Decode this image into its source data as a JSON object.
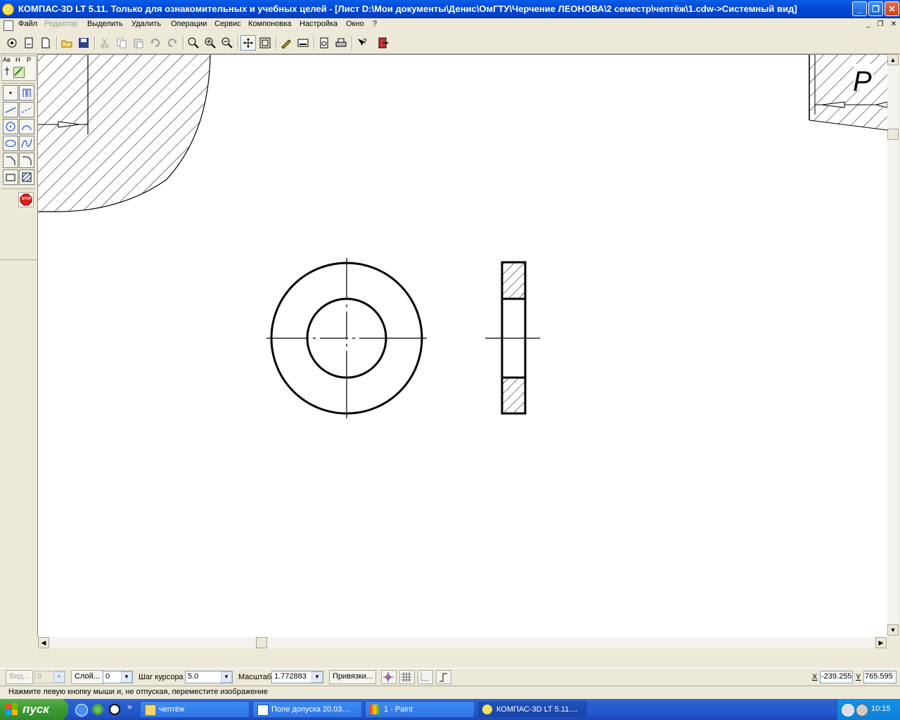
{
  "titlebar": {
    "title": "КОМПАС-3D LT 5.11. Только для ознакомительных и учебных целей - [Лист D:\\Мои документы\\Денис\\ОмГТУ\\Черчение ЛЕОНОВА\\2 семестр\\чептёж\\1.cdw->Системный вид]"
  },
  "menu": {
    "items": [
      {
        "label": "Файл"
      },
      {
        "label": "Редактор"
      },
      {
        "label": "Выделить"
      },
      {
        "label": "Удалить"
      },
      {
        "label": "Операции"
      },
      {
        "label": "Сервис"
      },
      {
        "label": "Компоновка"
      },
      {
        "label": "Настройка"
      },
      {
        "label": "Окно"
      },
      {
        "label": "?"
      }
    ]
  },
  "toolbar": {
    "icons": [
      "new-sheet-icon",
      "new-fragment-icon",
      "new-document-icon",
      "open-icon",
      "save-icon",
      "cut-icon",
      "copy-icon",
      "paste-icon",
      "undo-icon",
      "redo-icon",
      "zoom-window-icon",
      "zoom-in-icon",
      "zoom-out-icon",
      "pan-icon",
      "zoom-all-icon",
      "properties-icon",
      "layers-icon",
      "print-preview-icon",
      "print-icon",
      "help-icon",
      "exit-icon"
    ]
  },
  "leftpanel": {
    "tabs": [
      "Ав",
      "Н",
      "Р"
    ],
    "stop_label": "STOP"
  },
  "drawing": {
    "top_right_label": "Р"
  },
  "status": {
    "view_label": "Вид...",
    "view_value": "0",
    "layer_button": "Слой...",
    "layer_value": "0",
    "cursor_step_label": "Шаг курсора",
    "cursor_step_value": "5.0",
    "scale_label": "Масштаб",
    "scale_value": "1.772883",
    "snaps_button": "Привязки...",
    "x_label": "X",
    "x_value": "-239.255",
    "y_label": "Y",
    "y_value": "765.595",
    "hint": "Нажмите левую кнопку мыши и, не отпуская, переместите изображение"
  },
  "taskbar": {
    "start_label": "пуск",
    "tasks": [
      {
        "label": "чептёж"
      },
      {
        "label": "Поле допуска 20.03...."
      },
      {
        "label": "1 - Paint"
      },
      {
        "label": "КОМПАС-3D LT 5.11...."
      }
    ],
    "clock": "10:15"
  },
  "colors": {
    "title_blue": "#0a5ee8",
    "taskbar_blue": "#245ad0",
    "start_green": "#3d9c35",
    "canvas": "#ffffff"
  }
}
